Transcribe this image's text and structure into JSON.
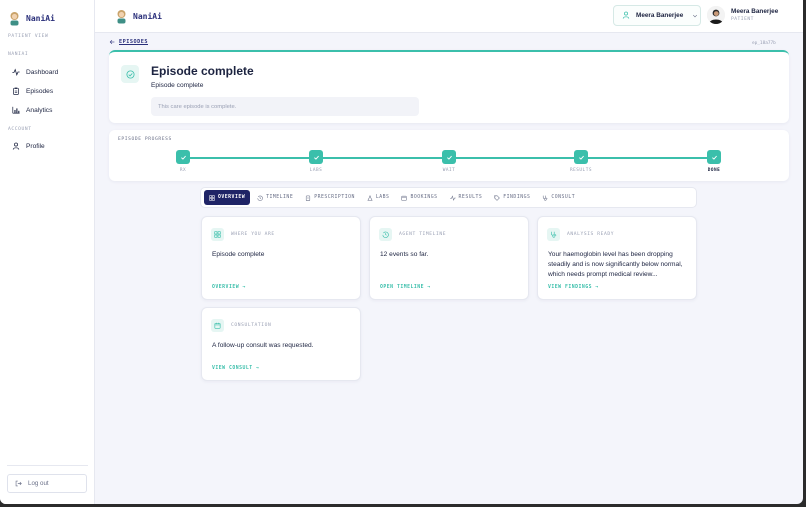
{
  "brand": {
    "name": "NaniAi"
  },
  "sidebar": {
    "section_view": "PATIENT VIEW",
    "section_main": "NANIAI",
    "items": [
      {
        "label": "Dashboard",
        "icon": "activity-icon"
      },
      {
        "label": "Episodes",
        "icon": "clipboard-icon"
      },
      {
        "label": "Analytics",
        "icon": "bar-chart-icon"
      }
    ],
    "section_account": "ACCOUNT",
    "account_items": [
      {
        "label": "Profile",
        "icon": "user-icon"
      }
    ],
    "logout_label": "Log out"
  },
  "topbar": {
    "patient_select": "Meera Banerjee",
    "user_name": "Meera Banerjee",
    "user_role": "PATIENT"
  },
  "breadcrumb": {
    "label": "EPISODES",
    "episode_id": "ep_18a77b"
  },
  "header": {
    "title": "Episode complete",
    "subtitle": "Episode complete",
    "note": "This care episode is complete."
  },
  "progress": {
    "label": "EPISODE PROGRESS",
    "steps": [
      "RX",
      "LABS",
      "WAIT",
      "RESULTS",
      "DONE"
    ],
    "current": "DONE"
  },
  "tabs": [
    {
      "label": "OVERVIEW",
      "active": true
    },
    {
      "label": "TIMELINE"
    },
    {
      "label": "PRESCRIPTION"
    },
    {
      "label": "LABS"
    },
    {
      "label": "BOOKINGS"
    },
    {
      "label": "RESULTS"
    },
    {
      "label": "FINDINGS"
    },
    {
      "label": "CONSULT"
    }
  ],
  "cards": {
    "where": {
      "label": "WHERE YOU ARE",
      "text": "Episode complete",
      "link": "OVERVIEW →"
    },
    "timeline": {
      "label": "AGENT TIMELINE",
      "text": "12 events so far.",
      "link": "OPEN TIMELINE →"
    },
    "analysis": {
      "label": "ANALYSIS READY",
      "text": "Your haemoglobin level has been dropping steadily and is now significantly below normal, which needs prompt medical review...",
      "link": "VIEW FINDINGS →"
    },
    "consult": {
      "label": "CONSULTATION",
      "text": "A follow-up consult was requested.",
      "link": "VIEW CONSULT →"
    }
  },
  "colors": {
    "accent": "#3bbfab",
    "brand": "#2a2f7a",
    "active_tab": "#1f2466"
  }
}
